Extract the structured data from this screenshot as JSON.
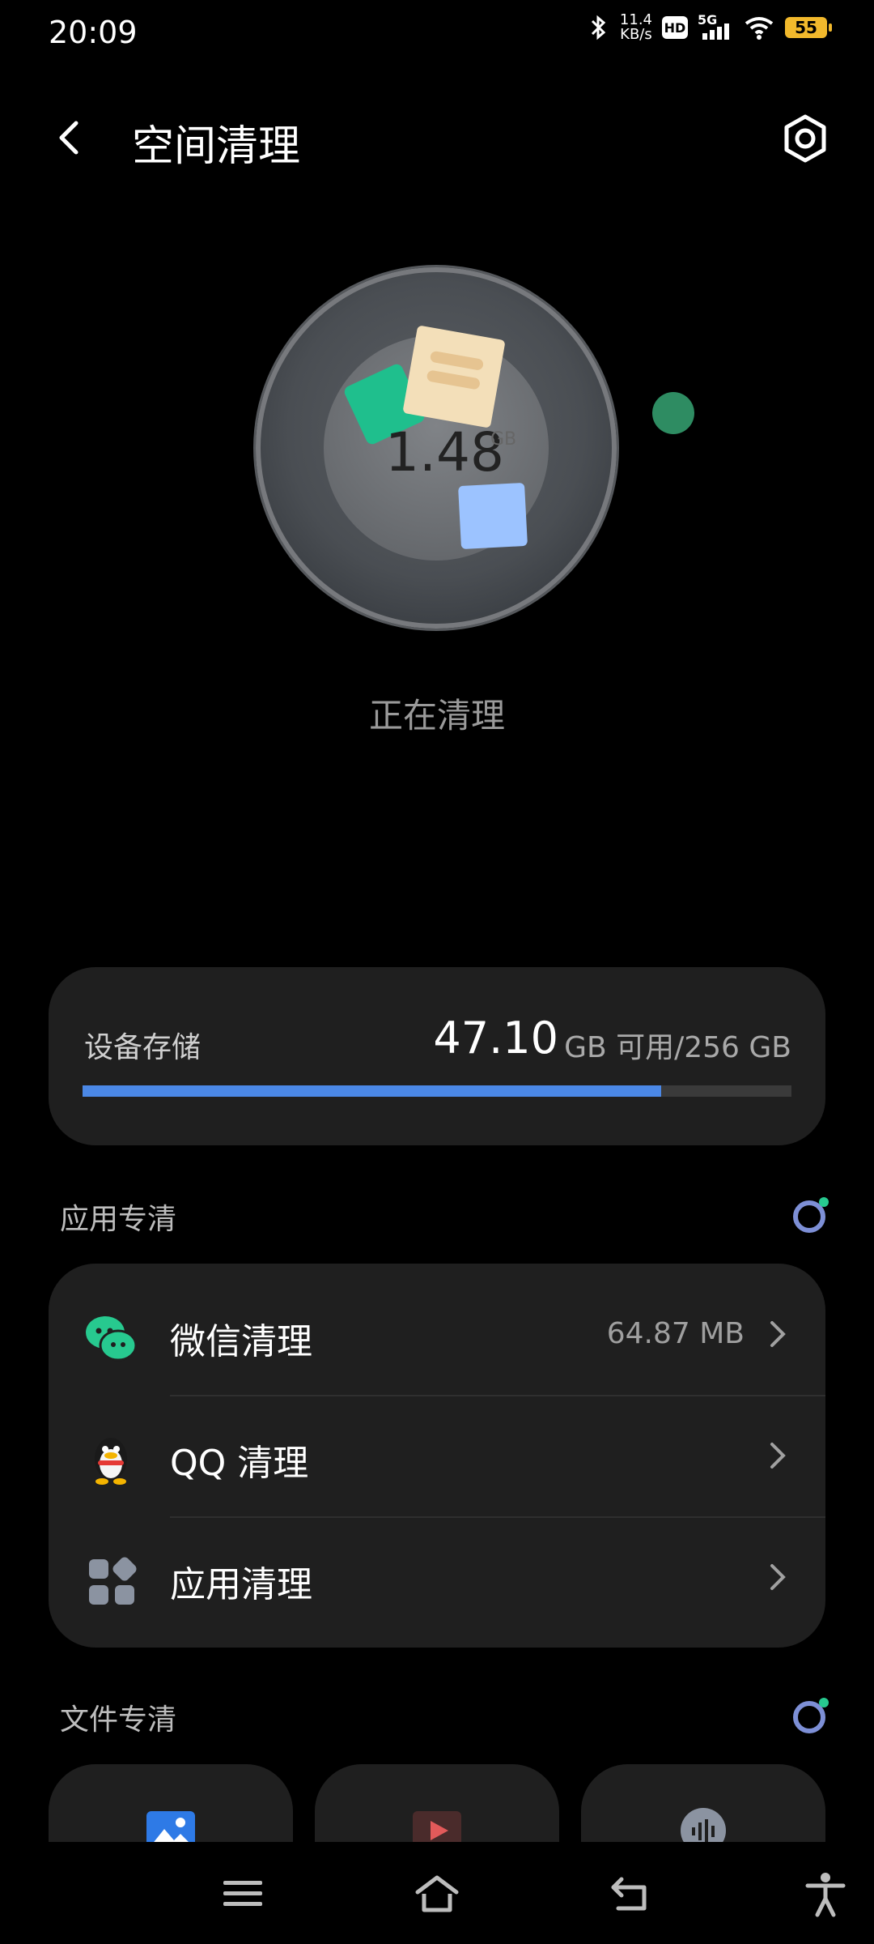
{
  "status_bar": {
    "time": "20:09",
    "net_speed_value": "11.4",
    "net_speed_unit": "KB/s",
    "hd_label": "HD",
    "network": "5G",
    "battery": "55"
  },
  "header": {
    "title": "空间清理",
    "back_icon": "chevron-left-icon",
    "settings_icon": "settings-hexagon-icon"
  },
  "hero": {
    "value": "1.48",
    "unit": "GB",
    "status": "正在清理"
  },
  "storage": {
    "label": "设备存储",
    "available": "47.10",
    "unit_text": "GB 可用/256 GB",
    "used_fraction": 0.816
  },
  "apps_section": {
    "title": "应用专清",
    "rows": [
      {
        "label": "微信清理",
        "size": "64.87 MB",
        "icon": "wechat-icon"
      },
      {
        "label": "QQ 清理",
        "size": "",
        "icon": "qq-icon"
      },
      {
        "label": "应用清理",
        "size": "",
        "icon": "apps-grid-icon"
      }
    ]
  },
  "files_section": {
    "title": "文件专清",
    "cards": [
      {
        "icon": "image-icon"
      },
      {
        "icon": "video-icon"
      },
      {
        "icon": "audio-icon"
      }
    ]
  },
  "nav": {
    "icons": [
      "menu-icon",
      "home-icon",
      "back-icon",
      "accessibility-icon"
    ]
  },
  "colors": {
    "accent_blue": "#4b88e6",
    "card_bg": "#1f1f1f",
    "wechat_green": "#27c98f"
  }
}
